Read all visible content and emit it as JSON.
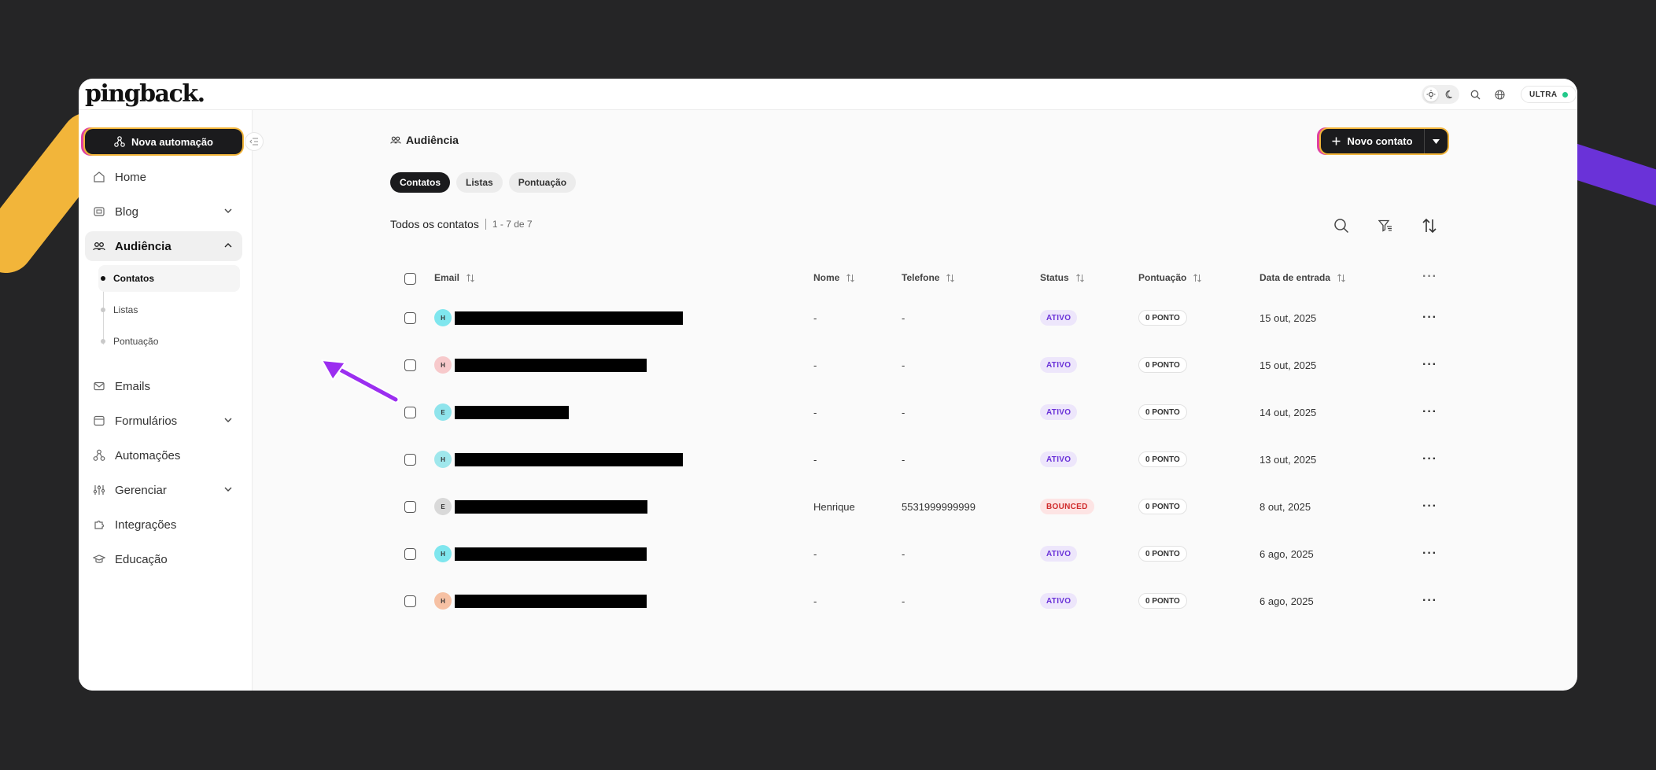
{
  "app": {
    "logo": "pingback.",
    "plan": "ULTRA"
  },
  "colors": {
    "accent_dark": "#1b1b1d",
    "ativo": "#6a32d8",
    "bounced": "#d02a2a",
    "plan_dot": "#22c98a",
    "highlight_arrow": "#9b2ef0"
  },
  "sidebar": {
    "new_automation": "Nova automação",
    "items": [
      {
        "label": "Home",
        "icon": "home-icon"
      },
      {
        "label": "Blog",
        "icon": "blog-icon",
        "expandable": true
      },
      {
        "label": "Audiência",
        "icon": "audience-icon",
        "expandable": true,
        "expanded": true
      },
      {
        "label": "Emails",
        "icon": "mail-icon"
      },
      {
        "label": "Formulários",
        "icon": "form-icon",
        "expandable": true
      },
      {
        "label": "Automações",
        "icon": "automation-icon"
      },
      {
        "label": "Gerenciar",
        "icon": "sliders-icon",
        "expandable": true
      },
      {
        "label": "Integrações",
        "icon": "puzzle-icon"
      },
      {
        "label": "Educação",
        "icon": "graduation-cap-icon"
      }
    ],
    "sub_items": [
      {
        "label": "Contatos"
      },
      {
        "label": "Listas"
      },
      {
        "label": "Pontuação"
      }
    ]
  },
  "main": {
    "title": "Audiência",
    "new_contact": "Novo contato",
    "tabs": [
      {
        "label": "Contatos"
      },
      {
        "label": "Listas"
      },
      {
        "label": "Pontuação"
      }
    ],
    "list_title": "Todos os contatos",
    "list_count": "1 - 7 de 7",
    "columns": {
      "email": "Email",
      "name": "Nome",
      "phone": "Telefone",
      "status": "Status",
      "score": "Pontuação",
      "date": "Data de entrada"
    },
    "rows": [
      {
        "initial": "H",
        "avatar_color": "#7fe6ee",
        "name": "-",
        "phone": "-",
        "status": "ATIVO",
        "score": "0 PONTO",
        "date": "15 out, 2025"
      },
      {
        "initial": "H",
        "avatar_color": "#f7c9cb",
        "name": "-",
        "phone": "-",
        "status": "ATIVO",
        "score": "0 PONTO",
        "date": "15 out, 2025"
      },
      {
        "initial": "E",
        "avatar_color": "#8fe4ec",
        "name": "-",
        "phone": "-",
        "status": "ATIVO",
        "score": "0 PONTO",
        "date": "14 out, 2025"
      },
      {
        "initial": "H",
        "avatar_color": "#9fe7ec",
        "name": "-",
        "phone": "-",
        "status": "ATIVO",
        "score": "0 PONTO",
        "date": "13 out, 2025"
      },
      {
        "initial": "E",
        "avatar_color": "#d9d9d9",
        "name": "Henrique",
        "phone": "5531999999999",
        "status": "BOUNCED",
        "score": "0 PONTO",
        "date": "8 out, 2025"
      },
      {
        "initial": "H",
        "avatar_color": "#7fe6ee",
        "name": "-",
        "phone": "-",
        "status": "ATIVO",
        "score": "0 PONTO",
        "date": "6 ago, 2025"
      },
      {
        "initial": "H",
        "avatar_color": "#f6c1a4",
        "name": "-",
        "phone": "-",
        "status": "ATIVO",
        "score": "0 PONTO",
        "date": "6 ago, 2025"
      }
    ]
  }
}
